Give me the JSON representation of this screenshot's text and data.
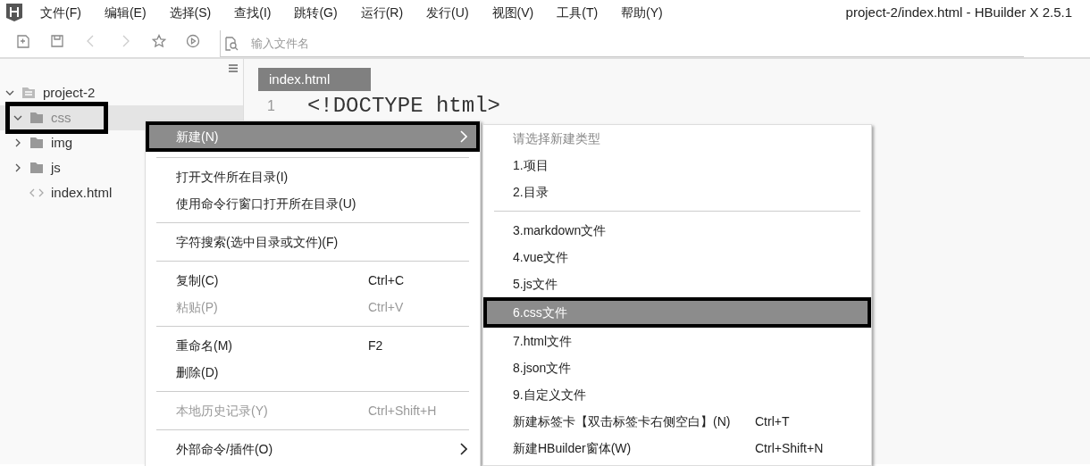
{
  "menu_bar": [
    "文件(F)",
    "编辑(E)",
    "选择(S)",
    "查找(I)",
    "跳转(G)",
    "运行(R)",
    "发行(U)",
    "视图(V)",
    "工具(T)",
    "帮助(Y)"
  ],
  "window": {
    "title": "project-2/index.html - HBuilder X 2.5.1"
  },
  "toolbar": {
    "search": {
      "placeholder": "输入文件名"
    }
  },
  "sidebar": {
    "tree": [
      {
        "label": "project-2",
        "kind": "project",
        "expanded": true,
        "selected": false,
        "highlighted": false,
        "children": [
          {
            "label": "css",
            "kind": "folder",
            "expanded": true,
            "selected": true,
            "highlighted": true
          },
          {
            "label": "img",
            "kind": "folder",
            "expanded": false,
            "selected": false,
            "highlighted": false
          },
          {
            "label": "js",
            "kind": "folder",
            "expanded": false,
            "selected": false,
            "highlighted": false
          },
          {
            "label": "index.html",
            "kind": "file",
            "selected": false,
            "highlighted": false
          }
        ]
      }
    ]
  },
  "editor": {
    "tabs": [
      {
        "label": "index.html",
        "selected": true
      }
    ],
    "line_number": "1",
    "code": "<!DOCTYPE html>"
  },
  "context_menu": {
    "items": [
      {
        "kind": "submenu",
        "label": "新建(N)",
        "disabled": false,
        "selected": true,
        "highlighted": true
      },
      {
        "kind": "separator"
      },
      {
        "kind": "item",
        "label": "打开文件所在目录(I)",
        "disabled": false,
        "selected": false,
        "highlighted": false
      },
      {
        "kind": "item",
        "label": "使用命令行窗口打开所在目录(U)",
        "disabled": false,
        "selected": false,
        "highlighted": false
      },
      {
        "kind": "separator"
      },
      {
        "kind": "item",
        "label": "字符搜索(选中目录或文件)(F)",
        "disabled": false,
        "selected": false,
        "highlighted": false
      },
      {
        "kind": "separator"
      },
      {
        "kind": "item",
        "label": "复制(C)",
        "shortcut": "Ctrl+C",
        "disabled": false,
        "selected": false,
        "highlighted": false
      },
      {
        "kind": "item",
        "label": "粘贴(P)",
        "shortcut": "Ctrl+V",
        "disabled": true,
        "selected": false,
        "highlighted": false
      },
      {
        "kind": "separator"
      },
      {
        "kind": "item",
        "label": "重命名(M)",
        "shortcut": "F2",
        "disabled": false,
        "selected": false,
        "highlighted": false
      },
      {
        "kind": "item",
        "label": "删除(D)",
        "disabled": false,
        "selected": false,
        "highlighted": false
      },
      {
        "kind": "separator"
      },
      {
        "kind": "item",
        "label": "本地历史记录(Y)",
        "shortcut": "Ctrl+Shift+H",
        "disabled": true,
        "selected": false,
        "highlighted": false
      },
      {
        "kind": "separator"
      },
      {
        "kind": "submenu",
        "label": "外部命令/插件(O)",
        "disabled": false,
        "selected": false,
        "highlighted": false
      }
    ]
  },
  "submenu": {
    "items": [
      {
        "kind": "header",
        "label": "请选择新建类型"
      },
      {
        "kind": "item",
        "label": "1.项目",
        "disabled": false,
        "selected": false,
        "highlighted": false
      },
      {
        "kind": "item",
        "label": "2.目录",
        "disabled": false,
        "selected": false,
        "highlighted": false
      },
      {
        "kind": "separator"
      },
      {
        "kind": "item",
        "label": "3.markdown文件",
        "disabled": false,
        "selected": false,
        "highlighted": false
      },
      {
        "kind": "item",
        "label": "4.vue文件",
        "disabled": false,
        "selected": false,
        "highlighted": false
      },
      {
        "kind": "item",
        "label": "5.js文件",
        "disabled": false,
        "selected": false,
        "highlighted": false
      },
      {
        "kind": "item",
        "label": "6.css文件",
        "disabled": false,
        "selected": true,
        "highlighted": true
      },
      {
        "kind": "item",
        "label": "7.html文件",
        "disabled": false,
        "selected": false,
        "highlighted": false
      },
      {
        "kind": "item",
        "label": "8.json文件",
        "disabled": false,
        "selected": false,
        "highlighted": false
      },
      {
        "kind": "item",
        "label": "9.自定义文件",
        "disabled": false,
        "selected": false,
        "highlighted": false
      },
      {
        "kind": "item",
        "label": "新建标签卡【双击标签卡右侧空白】(N)",
        "shortcut": "Ctrl+T",
        "disabled": false,
        "selected": false,
        "highlighted": false
      },
      {
        "kind": "item",
        "label": "新建HBuilder窗体(W)",
        "shortcut": "Ctrl+Shift+N",
        "disabled": false,
        "selected": false,
        "highlighted": false
      }
    ]
  }
}
